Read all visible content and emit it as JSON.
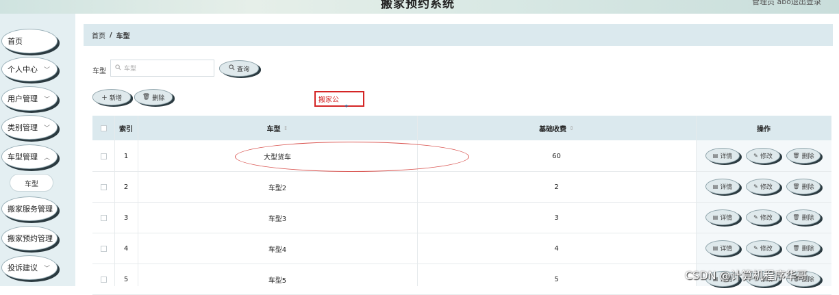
{
  "header": {
    "title": "搬家预约系统",
    "user": "管理员 abo",
    "logout": "退出登录"
  },
  "sidebar": {
    "items": [
      {
        "label": "首页",
        "chevron": false
      },
      {
        "label": "个人中心",
        "chevron": true
      },
      {
        "label": "用户管理",
        "chevron": true
      },
      {
        "label": "类别管理",
        "chevron": true
      },
      {
        "label": "车型管理",
        "chevron": true
      },
      {
        "label": "搬家服务管理",
        "chevron": false
      },
      {
        "label": "搬家预约管理",
        "chevron": false
      },
      {
        "label": "投诉建议",
        "chevron": true
      }
    ],
    "sub_item": "车型"
  },
  "breadcrumb": {
    "home": "首页",
    "separator": "/",
    "current": "车型"
  },
  "search": {
    "label": "车型",
    "placeholder": "车型",
    "query_button": "查询"
  },
  "toolbar": {
    "add_button": "新增",
    "delete_button": "删除"
  },
  "annotation": {
    "text": "搬家公"
  },
  "table": {
    "headers": {
      "index": "索引",
      "vehicle_type": "车型",
      "base_fee": "基础收费",
      "actions": "操作"
    },
    "rows": [
      {
        "index": "1",
        "vehicle_type": "大型货车",
        "base_fee": "60"
      },
      {
        "index": "2",
        "vehicle_type": "车型2",
        "base_fee": "2"
      },
      {
        "index": "3",
        "vehicle_type": "车型3",
        "base_fee": "3"
      },
      {
        "index": "4",
        "vehicle_type": "车型4",
        "base_fee": "4"
      },
      {
        "index": "5",
        "vehicle_type": "车型5",
        "base_fee": "5"
      }
    ],
    "row_actions": {
      "detail": "详情",
      "edit": "修改",
      "delete": "删除"
    }
  },
  "watermark": "CSDN @计算机程序华哥"
}
